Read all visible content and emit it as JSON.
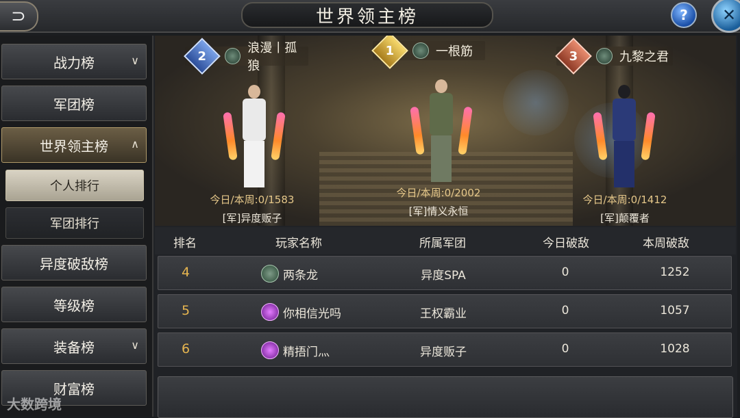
{
  "header": {
    "title": "世界领主榜",
    "back_glyph": "⊃",
    "help_glyph": "?",
    "close_glyph": "✕"
  },
  "sidebar": {
    "items": [
      {
        "label": "战力榜",
        "chevron": "∨"
      },
      {
        "label": "军团榜"
      },
      {
        "label": "世界领主榜",
        "chevron": "∧",
        "active": true
      },
      {
        "label": "个人排行",
        "sub": true,
        "selected": true
      },
      {
        "label": "军团排行",
        "sub": true
      },
      {
        "label": "异度破敌榜"
      },
      {
        "label": "等级榜"
      },
      {
        "label": "装备榜",
        "chevron": "∨"
      },
      {
        "label": "财富榜"
      }
    ]
  },
  "podium": {
    "first": {
      "rank": "1",
      "name": "一根筋",
      "stat": "今日/本周:0/2002",
      "guild": "[军]情义永恒"
    },
    "second": {
      "rank": "2",
      "name": "浪漫丨孤狼",
      "stat": "今日/本周:0/1583",
      "guild": "[军]异度贩子"
    },
    "third": {
      "rank": "3",
      "name": "九黎之君",
      "stat": "今日/本周:0/1412",
      "guild": "[军]颠覆者"
    }
  },
  "table": {
    "headers": [
      "排名",
      "玩家名称",
      "所属军团",
      "今日破敌",
      "本周破敌"
    ],
    "rows": [
      {
        "rank": "4",
        "name": "两条龙",
        "icon": "axe-icon",
        "guild": "异度SPA",
        "today": "0",
        "week": "1252"
      },
      {
        "rank": "5",
        "name": "你相信光吗",
        "icon": "gem-icon",
        "guild": "王权霸业",
        "today": "0",
        "week": "1057"
      },
      {
        "rank": "6",
        "name": "精捂门灬",
        "icon": "gem-icon",
        "guild": "异度贩子",
        "today": "0",
        "week": "1028"
      }
    ]
  },
  "watermark": "大数跨境",
  "colors": {
    "rank_gold": "#e7b650",
    "stat_text": "#e6c88a",
    "accent_blue": "#1a4fa8"
  }
}
